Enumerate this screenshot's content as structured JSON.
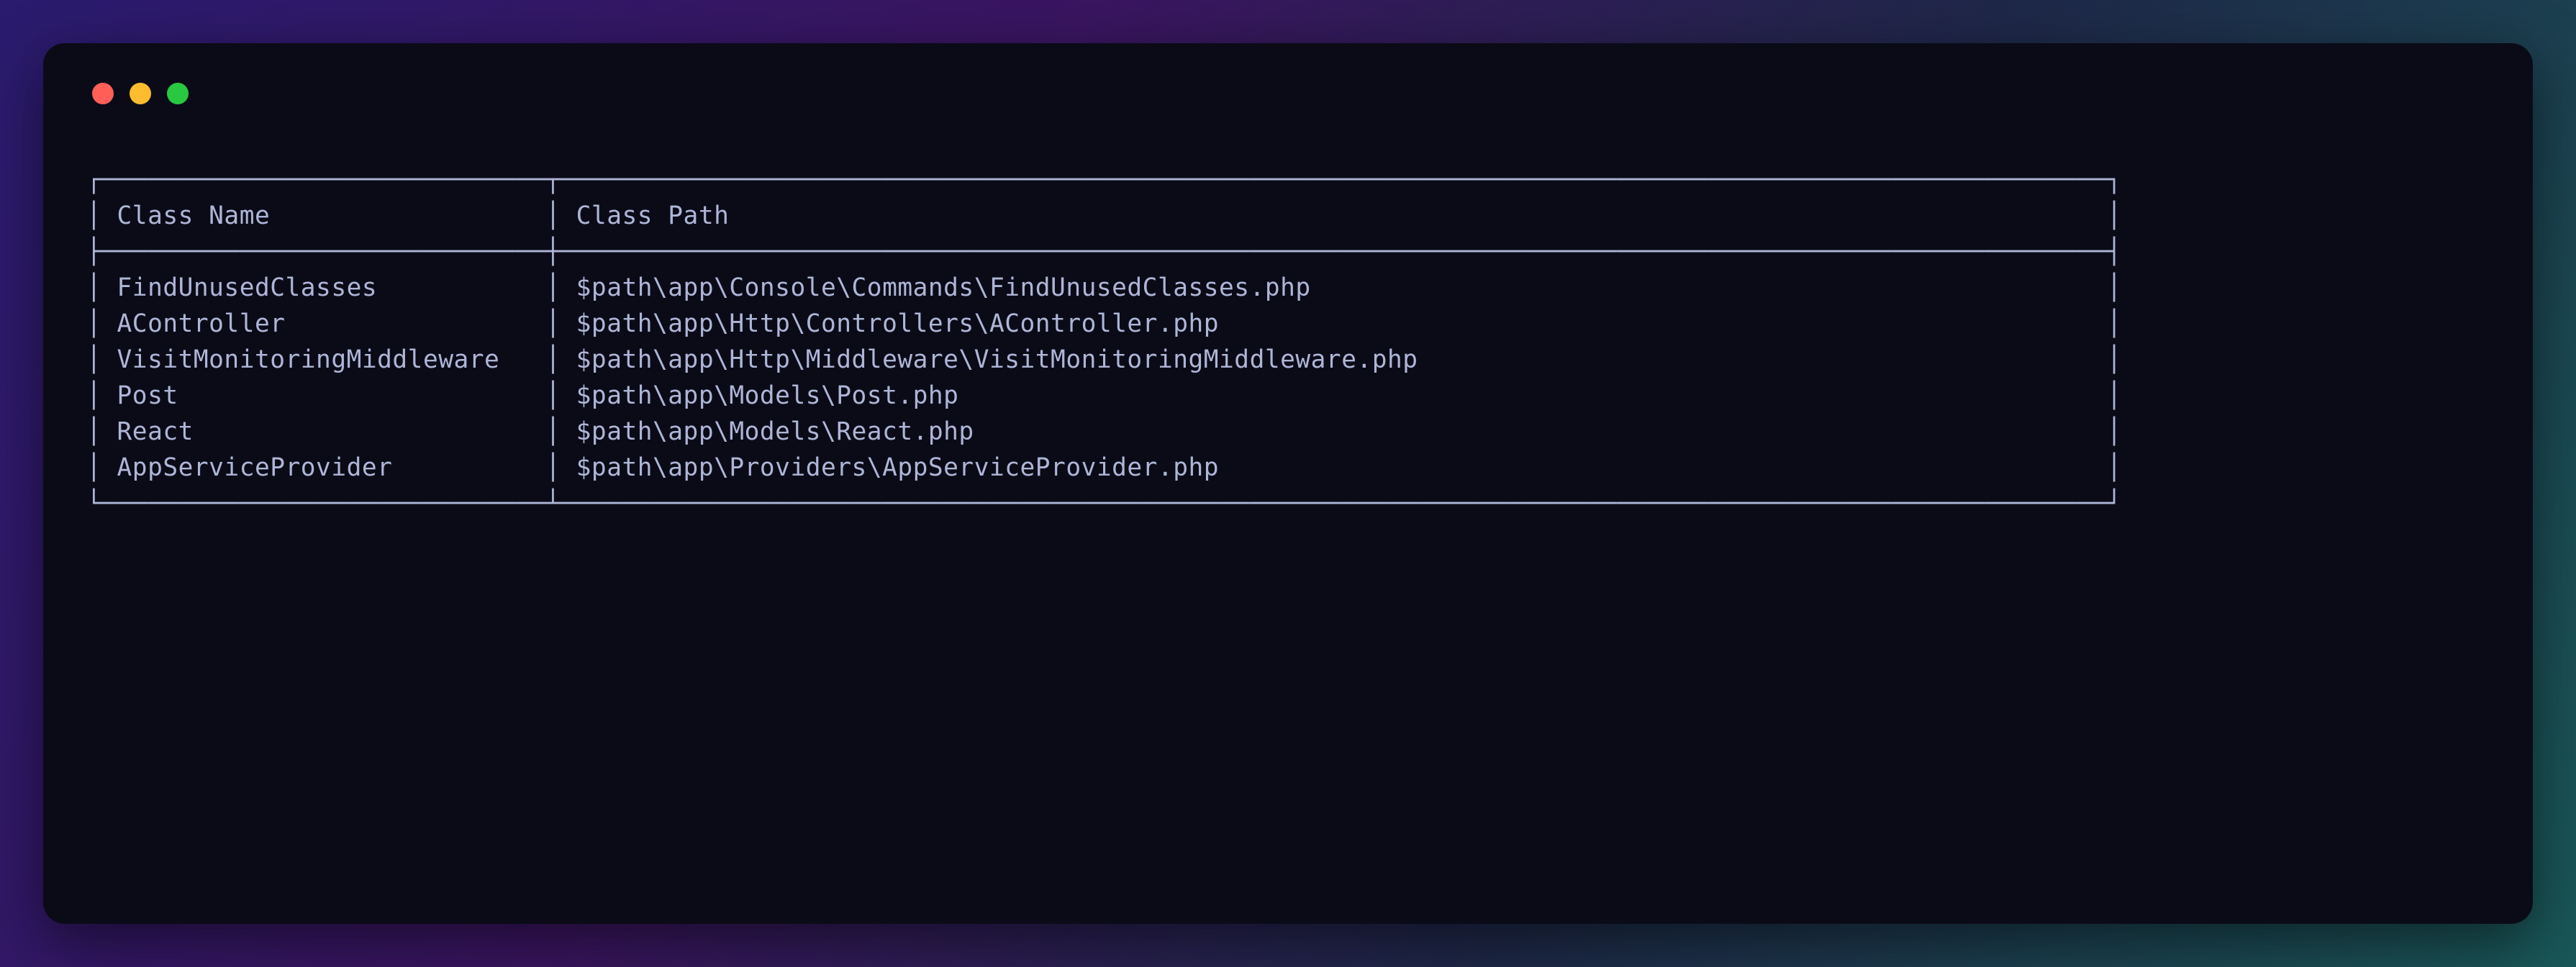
{
  "table": {
    "headers": {
      "name": "Class Name",
      "path": "Class Path"
    },
    "rows": [
      {
        "name": "FindUnusedClasses",
        "path": "$path\\app\\Console\\Commands\\FindUnusedClasses.php"
      },
      {
        "name": "AController",
        "path": "$path\\app\\Http\\Controllers\\AController.php"
      },
      {
        "name": "VisitMonitoringMiddleware",
        "path": "$path\\app\\Http\\Middleware\\VisitMonitoringMiddleware.php"
      },
      {
        "name": "Post",
        "path": "$path\\app\\Models\\Post.php"
      },
      {
        "name": "React",
        "path": "$path\\app\\Models\\React.php"
      },
      {
        "name": "AppServiceProvider",
        "path": "$path\\app\\Providers\\AppServiceProvider.php"
      }
    ],
    "col1_width": 27,
    "col2_width": 99
  },
  "box_chars": {
    "h": "─",
    "v": "│",
    "tl": "┌",
    "tr": "┐",
    "bl": "└",
    "br": "┘",
    "t_down": "┬",
    "t_up": "┴",
    "t_right": "├",
    "t_left": "┤",
    "cross": "┼"
  }
}
